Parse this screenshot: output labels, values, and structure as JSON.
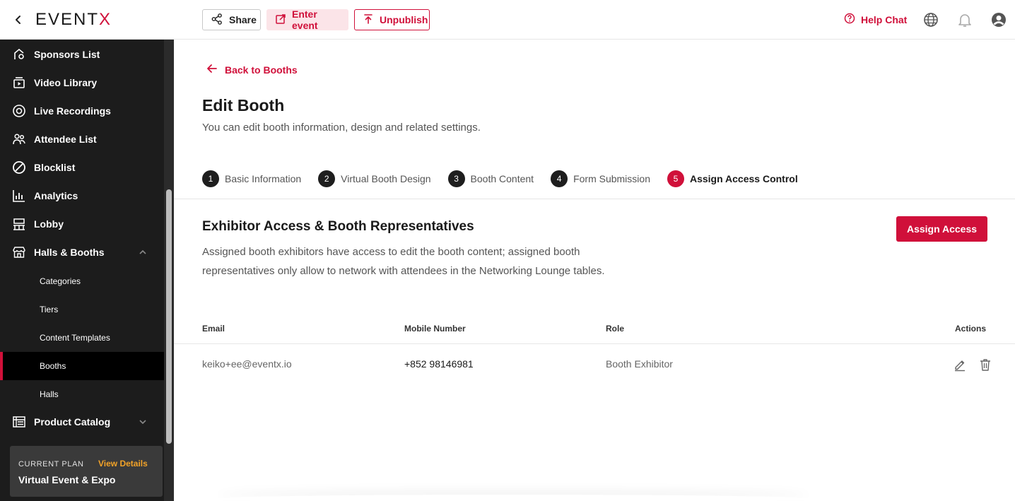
{
  "topbar": {
    "logo_main": "EVENT",
    "logo_x": "X",
    "share_label": "Share",
    "enter_label": "Enter event",
    "unpublish_label": "Unpublish",
    "help_label": "Help Chat",
    "icons": [
      "back-chevron-icon",
      "share-icon",
      "external-link-icon",
      "upload-icon",
      "help-circle-icon",
      "globe-icon",
      "bell-icon",
      "user-circle-icon"
    ]
  },
  "sidebar": {
    "items": [
      {
        "label": "Sponsors List",
        "icon": "sponsor-icon"
      },
      {
        "label": "Video Library",
        "icon": "video-library-icon"
      },
      {
        "label": "Live Recordings",
        "icon": "record-icon"
      },
      {
        "label": "Attendee List",
        "icon": "users-icon"
      },
      {
        "label": "Blocklist",
        "icon": "block-icon"
      },
      {
        "label": "Analytics",
        "icon": "bar-chart-icon"
      },
      {
        "label": "Lobby",
        "icon": "lobby-icon"
      },
      {
        "label": "Halls & Booths",
        "icon": "store-icon",
        "expanded": true
      }
    ],
    "subitems": [
      {
        "label": "Categories"
      },
      {
        "label": "Tiers"
      },
      {
        "label": "Content Templates"
      },
      {
        "label": "Booths",
        "active": true
      },
      {
        "label": "Halls"
      }
    ],
    "product_catalog": {
      "label": "Product Catalog",
      "icon": "catalog-icon"
    },
    "plan": {
      "caption": "CURRENT PLAN",
      "link": "View Details",
      "name": "Virtual Event & Expo"
    }
  },
  "main": {
    "back_label": "Back to Booths",
    "title": "Edit Booth",
    "subtitle": "You can edit booth information, design and related settings.",
    "steps": [
      {
        "num": "1",
        "label": "Basic Information"
      },
      {
        "num": "2",
        "label": "Virtual Booth Design"
      },
      {
        "num": "3",
        "label": "Booth Content"
      },
      {
        "num": "4",
        "label": "Form Submission"
      },
      {
        "num": "5",
        "label": "Assign Access Control",
        "active": true
      }
    ],
    "section_title": "Exhibitor Access & Booth Representatives",
    "section_desc": "Assigned booth exhibitors have access to edit the booth content; assigned booth representatives only allow to network with attendees in the Networking Lounge tables.",
    "assign_button": "Assign Access",
    "table": {
      "headers": [
        "Email",
        "Mobile Number",
        "Role",
        "Actions"
      ],
      "rows": [
        {
          "email": "keiko+ee@eventx.io",
          "mobile": "+852 98146981",
          "role": "Booth Exhibitor"
        }
      ]
    }
  },
  "colors": {
    "accent": "#d0103a",
    "sidebar_bg": "#1c1c1c",
    "plan_link": "#f3a328"
  }
}
